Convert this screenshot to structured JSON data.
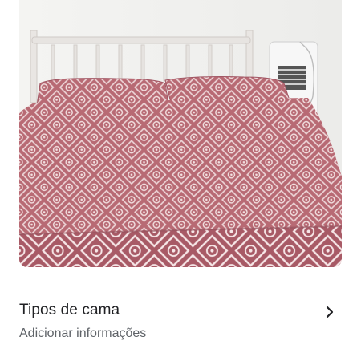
{
  "photo": {
    "subject": "bed-photo",
    "bedspread_color": "#b86a74",
    "pattern_color": "#f3e2e2"
  },
  "bed_types": {
    "title": "Tipos de cama",
    "subtitle": "Adicionar informações",
    "chevron_icon": "chevron-right-icon"
  }
}
